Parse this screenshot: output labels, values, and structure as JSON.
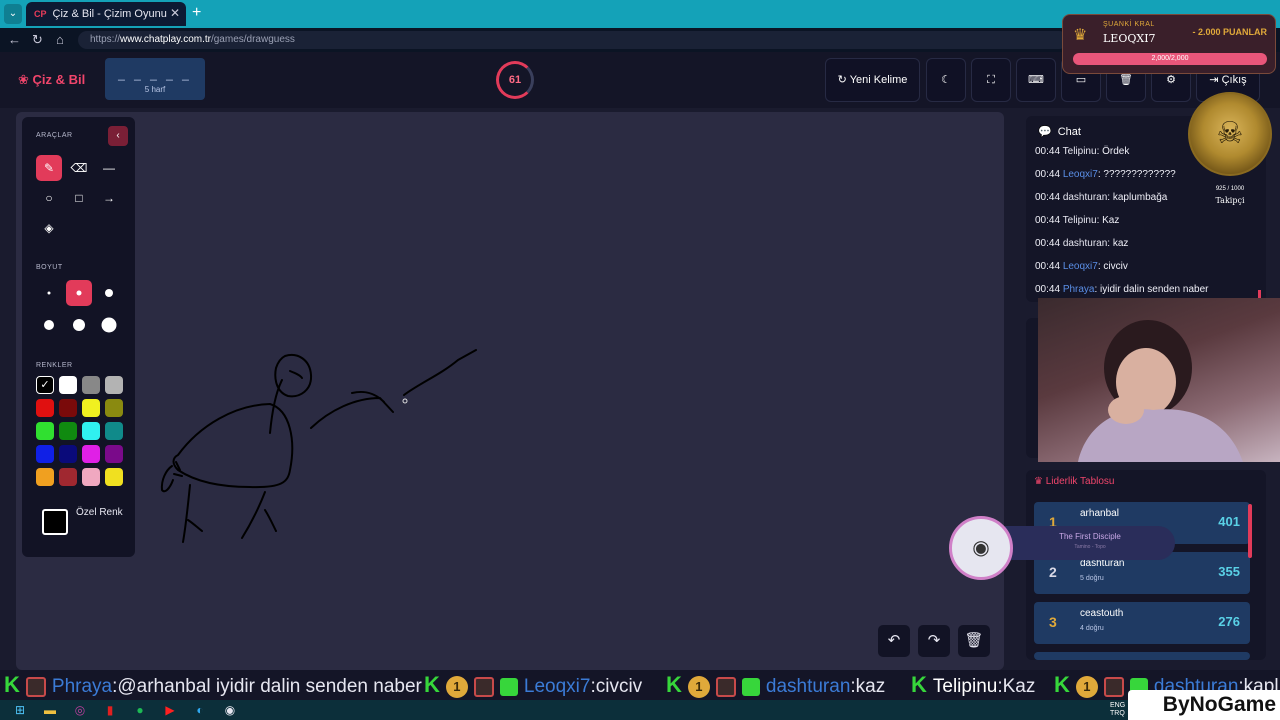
{
  "browser": {
    "tab_title": "Çiz & Bil - Çizim Oyunu",
    "tab_favicon": "CP",
    "url_scheme": "https://",
    "url_host": "www.chatplay.com.tr",
    "url_path": "/games/drawguess"
  },
  "header": {
    "logo": "Çiz & Bil",
    "word_mask": "_ _ _ _ _",
    "word_length": "5 harf",
    "timer": "61",
    "timer_fraction": 0.75,
    "new_word_label": "Yeni Kelime",
    "exit_label": "Çıkış"
  },
  "tools": {
    "tools_label": "ARAÇLAR",
    "size_label": "BOYUT",
    "colors_label": "RENKLER",
    "custom_color_label": "Özel Renk",
    "colors": [
      "#000000",
      "#ffffff",
      "#888888",
      "#b3b3b3",
      "#e01010",
      "#7a0a0a",
      "#f0f020",
      "#8a8a10",
      "#30e030",
      "#108a10",
      "#30f0f0",
      "#108a8a",
      "#1020e6",
      "#0a0a7a",
      "#e020e6",
      "#7a0a8a",
      "#f0a020",
      "#a02830",
      "#f0a8c0",
      "#f0e020"
    ],
    "accent": "#e23b5a"
  },
  "chat": {
    "title": "Chat",
    "messages": [
      {
        "time": "00:44",
        "user": "Telipinu",
        "text": ": Ördek"
      },
      {
        "time": "00:44",
        "user": "Leoqxi7",
        "text": ": ?????????????"
      },
      {
        "time": "00:44",
        "user": "dashturan",
        "text": ": kaplumbağa"
      },
      {
        "time": "00:44",
        "user": "Telipinu",
        "text": ": Kaz"
      },
      {
        "time": "00:44",
        "user": "dashturan",
        "text": ": kaz"
      },
      {
        "time": "00:44",
        "user": "Leoqxi7",
        "text": ": civciv"
      },
      {
        "time": "00:44",
        "user": "Phraya",
        "text": ": iyidir dalin senden naber"
      }
    ]
  },
  "leaderboard": {
    "title": "Liderlik Tablosu",
    "rows": [
      {
        "rank": "1",
        "name": "arhanbal",
        "sub": "",
        "score": "401"
      },
      {
        "rank": "2",
        "name": "dashturan",
        "sub": "5 doğru",
        "score": "355"
      },
      {
        "rank": "3",
        "name": "ceastouth",
        "sub": "4 doğru",
        "score": "276"
      }
    ]
  },
  "overlay": {
    "king_label": "ŞUANKİ KRAL",
    "king_name": "LEOQXI7",
    "king_points": "- 2.000 PUANLAR",
    "king_bar_text": "2,000/2,000",
    "king_bar_fraction": 1.0,
    "follow_count": "925 / 1000",
    "follow_label": "Takipçi",
    "song_title": "The First Disciple",
    "song_artist": "Tamino - Topo"
  },
  "ticker": [
    {
      "user": "Phraya",
      "text": ":@arhanbal iyidir dalin senden naber"
    },
    {
      "user": "Leoqxi7",
      "text": ":civciv"
    },
    {
      "user": "dashturan",
      "text": ":kaz"
    },
    {
      "user": "Telipinu",
      "text": ":Kaz"
    },
    {
      "user": "dashturan",
      "text": ":kapl"
    }
  ],
  "tray": {
    "lang": "ENG",
    "region": "TRQ"
  },
  "watermark": "ByNoGame"
}
